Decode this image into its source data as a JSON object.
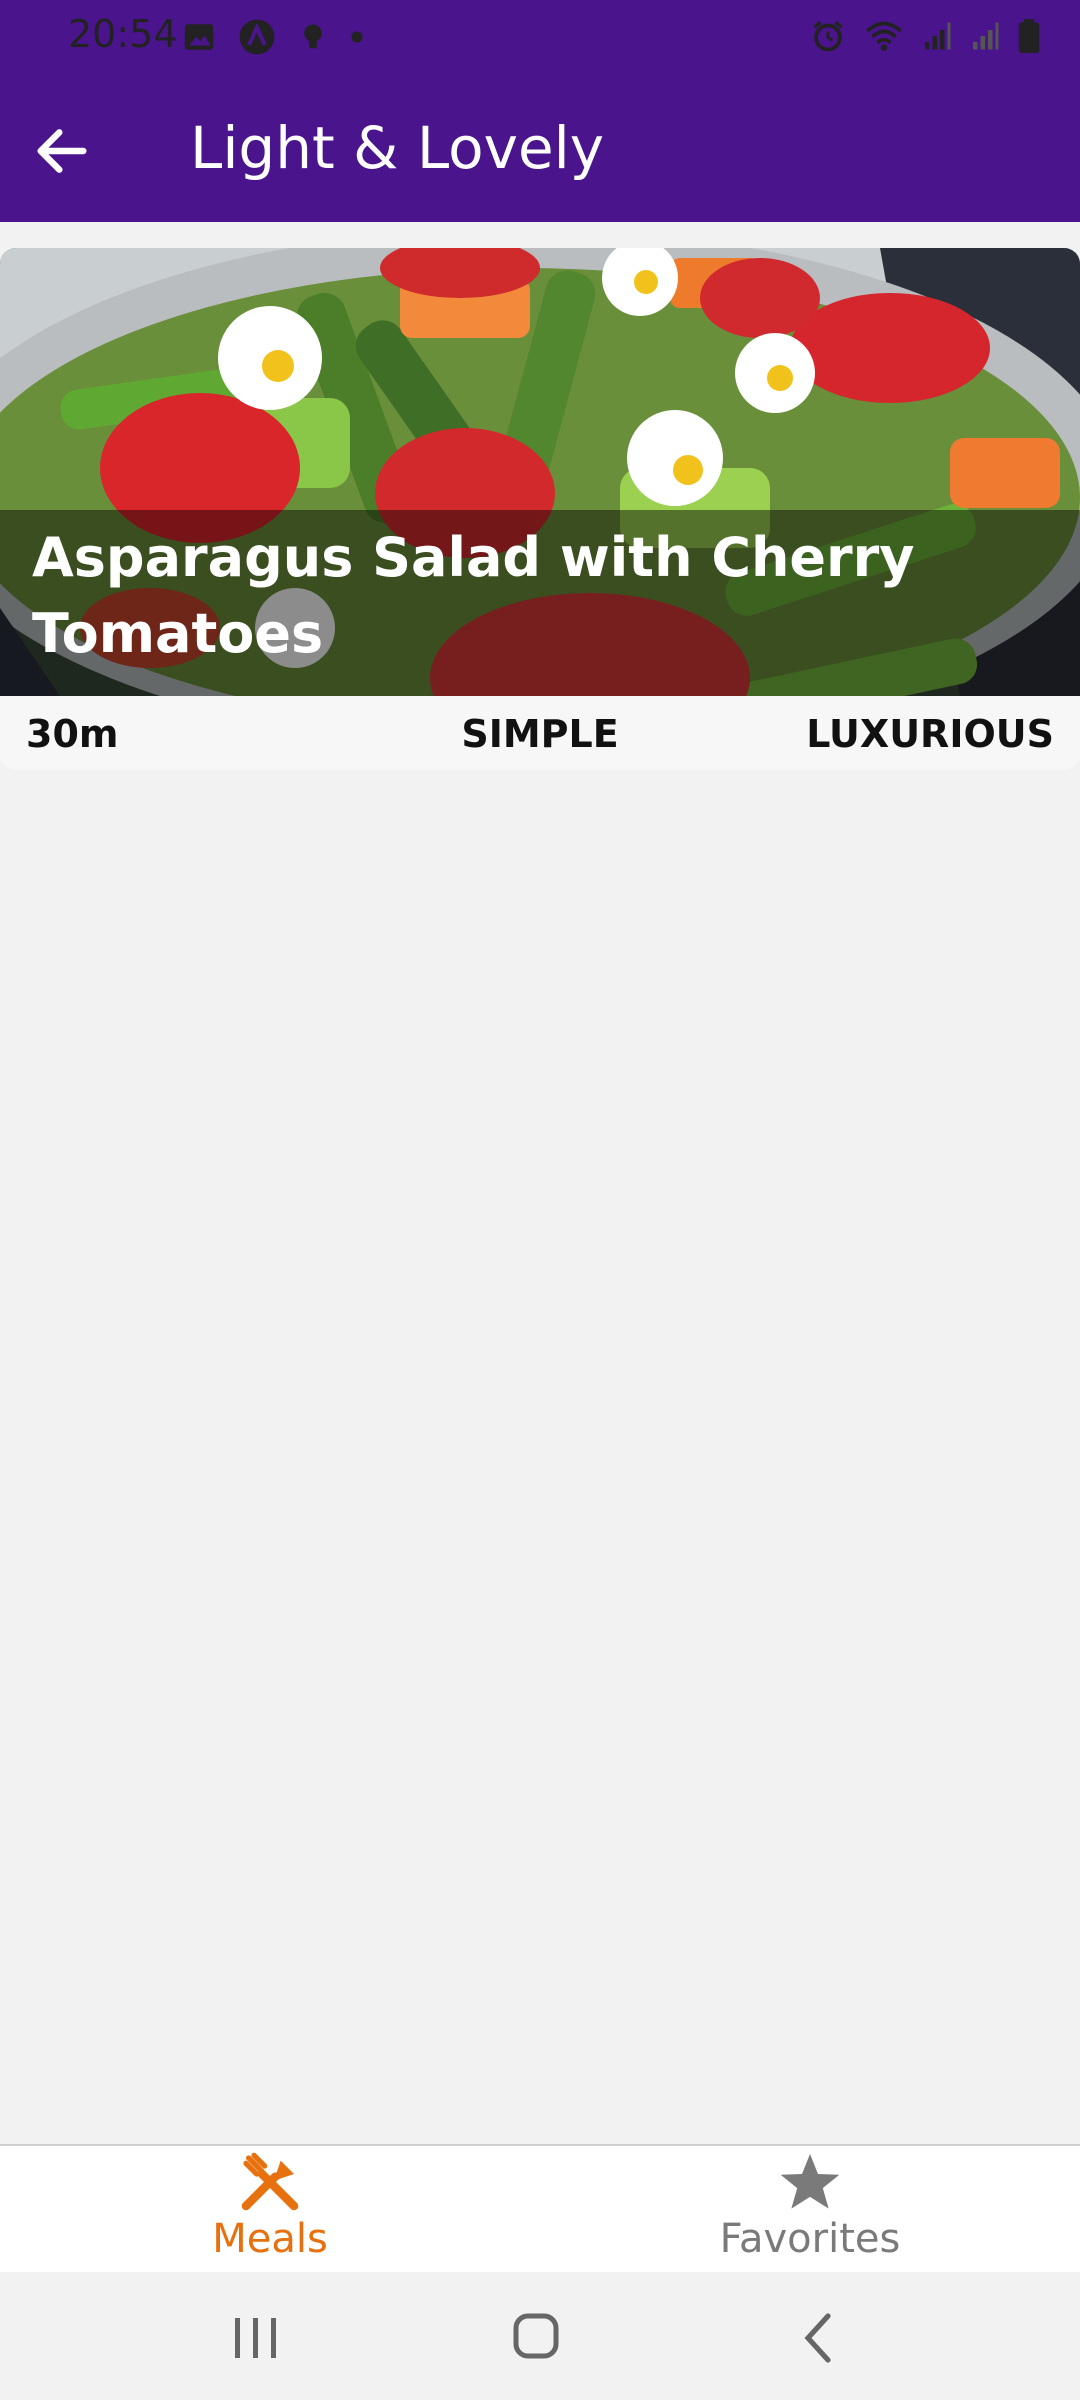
{
  "status_bar": {
    "time": "20:54",
    "left_icons": [
      "image-icon",
      "app-notification-icon",
      "bulb-icon",
      "dot-icon"
    ],
    "right_icons": [
      "alarm-icon",
      "wifi-icon",
      "signal-icon",
      "signal-icon",
      "battery-icon"
    ]
  },
  "app_bar": {
    "title": "Light & Lovely",
    "back_icon": "arrow-back-icon",
    "color": "#4a148c"
  },
  "meal": {
    "title": "Asparagus Salad with Cherry Tomatoes",
    "duration": "30m",
    "complexity": "SIMPLE",
    "affordability": "LUXURIOUS"
  },
  "bottom_nav": {
    "items": [
      {
        "label": "Meals",
        "icon": "fork-knife-icon",
        "active": true,
        "color": "#e8710f"
      },
      {
        "label": "Favorites",
        "icon": "star-icon",
        "active": false,
        "color": "#7a7a7a"
      }
    ]
  },
  "system_nav": {
    "buttons": [
      "recent-apps-icon",
      "home-icon",
      "back-icon"
    ]
  }
}
